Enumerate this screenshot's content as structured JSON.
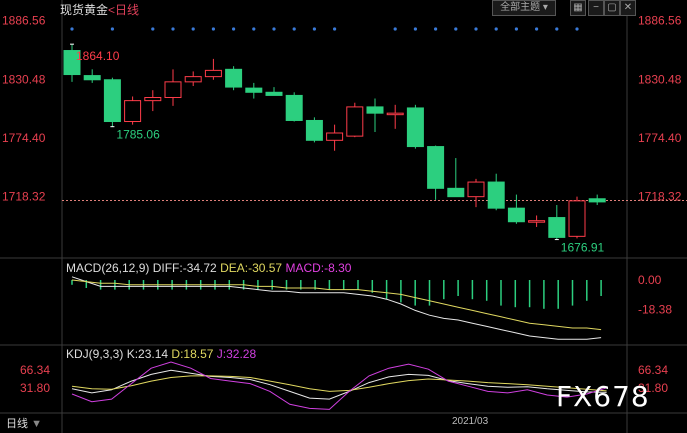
{
  "window": {
    "title": "现货黄金",
    "subtitle": "<日线",
    "board_button": "全部主题",
    "period_tab": "日线",
    "watermark": "FX678"
  },
  "chart_data": [
    {
      "type": "candlestick",
      "title": "现货黄金 <日线",
      "y_ticks": [
        "1886.56",
        "1830.48",
        "1774.40",
        "1718.32"
      ],
      "ylim": [
        1665,
        1893
      ],
      "annotations": [
        {
          "label": "1864.10",
          "bar": 0,
          "value": 1864.1,
          "position": "above"
        },
        {
          "label": "1785.06",
          "bar": 2,
          "value": 1785.06,
          "position": "below"
        },
        {
          "label": "1676.91",
          "bar": 24,
          "value": 1676.91,
          "position": "below"
        }
      ],
      "reference_line": 1714.3,
      "candles": [
        {
          "o": 1858,
          "h": 1864.1,
          "l": 1828,
          "c": 1835
        },
        {
          "o": 1834,
          "h": 1840,
          "l": 1827,
          "c": 1830
        },
        {
          "o": 1830,
          "h": 1832,
          "l": 1785.06,
          "c": 1790
        },
        {
          "o": 1790,
          "h": 1814,
          "l": 1787,
          "c": 1810
        },
        {
          "o": 1810,
          "h": 1820,
          "l": 1800,
          "c": 1813
        },
        {
          "o": 1813,
          "h": 1840,
          "l": 1805,
          "c": 1828
        },
        {
          "o": 1828,
          "h": 1838,
          "l": 1824,
          "c": 1833
        },
        {
          "o": 1833,
          "h": 1850,
          "l": 1830,
          "c": 1839
        },
        {
          "o": 1840,
          "h": 1843,
          "l": 1820,
          "c": 1823
        },
        {
          "o": 1822,
          "h": 1827,
          "l": 1812,
          "c": 1818
        },
        {
          "o": 1818,
          "h": 1823,
          "l": 1815,
          "c": 1815
        },
        {
          "o": 1815,
          "h": 1818,
          "l": 1790,
          "c": 1791
        },
        {
          "o": 1791,
          "h": 1794,
          "l": 1770,
          "c": 1772
        },
        {
          "o": 1772,
          "h": 1787,
          "l": 1762,
          "c": 1779
        },
        {
          "o": 1776,
          "h": 1808,
          "l": 1775,
          "c": 1804
        },
        {
          "o": 1804,
          "h": 1812,
          "l": 1780,
          "c": 1798
        },
        {
          "o": 1798,
          "h": 1806,
          "l": 1783,
          "c": 1798
        },
        {
          "o": 1803,
          "h": 1806,
          "l": 1764,
          "c": 1766
        },
        {
          "o": 1766,
          "h": 1767,
          "l": 1715,
          "c": 1726
        },
        {
          "o": 1726,
          "h": 1755,
          "l": 1719,
          "c": 1718
        },
        {
          "o": 1718,
          "h": 1735,
          "l": 1708,
          "c": 1732
        },
        {
          "o": 1732,
          "h": 1740,
          "l": 1705,
          "c": 1707
        },
        {
          "o": 1707,
          "h": 1720,
          "l": 1692,
          "c": 1694
        },
        {
          "o": 1694,
          "h": 1700,
          "l": 1689,
          "c": 1695
        },
        {
          "o": 1698,
          "h": 1710,
          "l": 1676.91,
          "c": 1679
        },
        {
          "o": 1680,
          "h": 1718,
          "l": 1678,
          "c": 1714
        },
        {
          "o": 1716,
          "h": 1720,
          "l": 1710,
          "c": 1713
        }
      ]
    },
    {
      "type": "macd",
      "legend": {
        "name": "MACD(26,12,9)",
        "diff": "DIFF:-34.72",
        "dea": "DEA:-30.57",
        "macd": "MACD:-8.30"
      },
      "y_ticks": [
        "0.00",
        "-18.38"
      ],
      "ylim": [
        -40,
        5
      ],
      "histogram": [
        -3,
        -5,
        -6,
        -6,
        -6,
        -6,
        -6,
        -6,
        -6,
        -6,
        -6,
        -6,
        -6,
        -6,
        -6,
        -6,
        -6,
        -6,
        -6,
        -6,
        -6,
        -8,
        -12,
        -14,
        -16,
        -16,
        -12,
        -10,
        -12,
        -13,
        -16,
        -17,
        -17,
        -18,
        -18,
        -16,
        -13,
        -10
      ],
      "diff": [
        2,
        -1,
        -4,
        -4,
        -4,
        -4,
        -4,
        -4,
        -4,
        -4,
        -4,
        -4,
        -5,
        -6,
        -7,
        -7,
        -8,
        -8,
        -8,
        -8,
        -9,
        -10,
        -12,
        -15,
        -19,
        -22,
        -24,
        -25,
        -27,
        -29,
        -31,
        -33,
        -35,
        -36,
        -37,
        -37,
        -37,
        -36
      ],
      "dea": [
        0,
        -1,
        -2,
        -2,
        -3,
        -3,
        -3,
        -3,
        -3,
        -3,
        -3,
        -3,
        -3,
        -4,
        -4,
        -5,
        -5,
        -5,
        -6,
        -6,
        -6,
        -7,
        -8,
        -9,
        -11,
        -13,
        -15,
        -17,
        -19,
        -21,
        -23,
        -25,
        -27,
        -28,
        -29,
        -30,
        -30,
        -31
      ]
    },
    {
      "type": "kdj",
      "legend": {
        "name": "KDJ(9,3,3)",
        "k": "K:23.14",
        "d": "D:18.57",
        "j": "J:32.28"
      },
      "y_ticks": [
        "66.34",
        "31.80"
      ],
      "ylim": [
        -15,
        82
      ],
      "k": [
        30,
        22,
        28,
        45,
        58,
        66,
        60,
        54,
        52,
        48,
        38,
        25,
        12,
        10,
        25,
        42,
        53,
        58,
        56,
        46,
        40,
        35,
        33,
        34,
        30,
        27,
        24,
        23
      ],
      "d": [
        35,
        30,
        29,
        36,
        45,
        52,
        55,
        55,
        54,
        52,
        45,
        38,
        30,
        25,
        27,
        33,
        40,
        46,
        49,
        47,
        45,
        42,
        40,
        38,
        35,
        32,
        29,
        26
      ],
      "j": [
        20,
        5,
        10,
        40,
        70,
        82,
        70,
        50,
        45,
        40,
        25,
        0,
        -8,
        -10,
        25,
        55,
        70,
        78,
        68,
        45,
        35,
        25,
        22,
        28,
        18,
        14,
        20,
        32
      ]
    }
  ],
  "x_axis": {
    "date_label": "2021/03"
  },
  "colors": {
    "up": "#ff3d4a",
    "down": "#2ccf7f",
    "diff": "#e8e8e8",
    "dea": "#e0d860",
    "macd_label": "#e040e0",
    "j": "#d040e0",
    "price_tick": "#e84050",
    "dot": "#3a7ad8"
  }
}
